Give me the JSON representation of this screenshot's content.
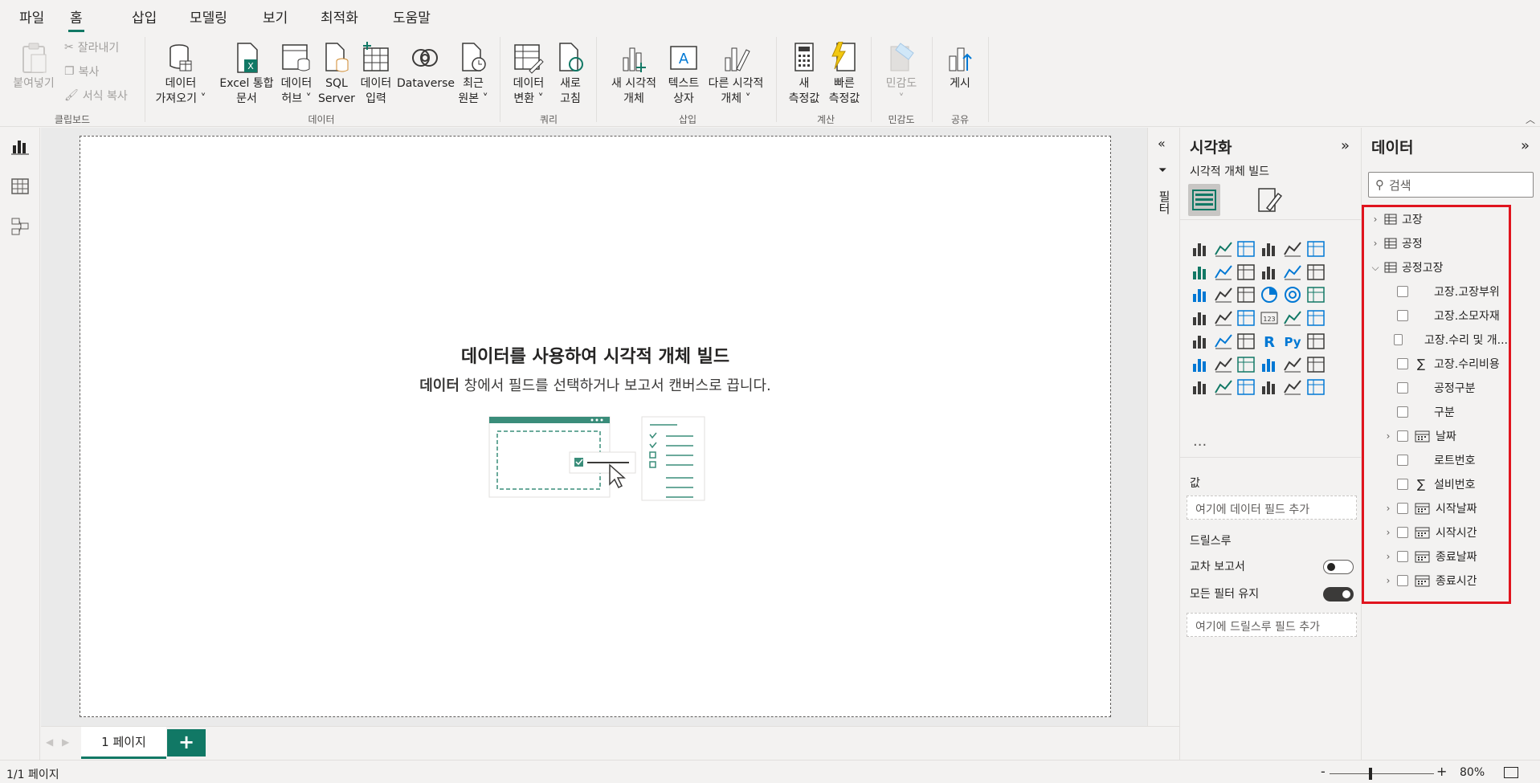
{
  "menu": [
    "파일",
    "홈",
    "삽입",
    "모델링",
    "보기",
    "최적화",
    "도움말"
  ],
  "ribbon": {
    "clipboard": {
      "paste": "붙여넣기",
      "cut": "잘라내기",
      "copy": "복사",
      "format_painter": "서식 복사",
      "group": "클립보드"
    },
    "data": {
      "get_data_1": "데이터",
      "get_data_2": "가져오기 ˅",
      "excel_1": "Excel 통합",
      "excel_2": "문서",
      "hub_1": "데이터",
      "hub_2": "허브 ˅",
      "sql_1": "SQL",
      "sql_2": "Server",
      "enter_1": "데이터",
      "enter_2": "입력",
      "dataverse": "Dataverse",
      "recent_1": "최근",
      "recent_2": "원본 ˅",
      "group": "데이터"
    },
    "query": {
      "transform_1": "데이터",
      "transform_2": "변환 ˅",
      "refresh_1": "새로",
      "refresh_2": "고침",
      "group": "쿼리"
    },
    "insert": {
      "newvisual_1": "새 시각적",
      "newvisual_2": "개체",
      "textbox_1": "텍스트",
      "textbox_2": "상자",
      "morevisuals_1": "다른 시각적",
      "morevisuals_2": "개체 ˅",
      "group": "삽입"
    },
    "calc": {
      "newmeasure_1": "새",
      "newmeasure_2": "측정값",
      "quickmeasure_1": "빠른",
      "quickmeasure_2": "측정값",
      "group": "계산"
    },
    "sensitivity": {
      "label": "민감도",
      "arrow": "˅",
      "group": "민감도"
    },
    "share": {
      "publish": "게시",
      "group": "공유"
    }
  },
  "canvas": {
    "title": "데이터를 사용하여 시각적 개체 빌드",
    "sub_bold": "데이터",
    "sub_rest": " 창에서 필드를 선택하거나 보고서 캔버스로 끕니다."
  },
  "filters_label": "필터",
  "viz": {
    "title": "시각화",
    "subtitle": "시각적 개체 빌드",
    "more": "...",
    "values_label": "값",
    "values_placeholder": "여기에 데이터 필드 추가",
    "drillthrough_label": "드릴스루",
    "cross_report": "교차 보고서",
    "keep_filters": "모든 필터 유지",
    "drill_placeholder": "여기에 드릴스루 필드 추가",
    "cross_report_on": false,
    "keep_filters_on": true
  },
  "data_pane": {
    "title": "데이터",
    "search_placeholder": "검색",
    "tables": [
      {
        "name": "고장",
        "expanded": false
      },
      {
        "name": "공정",
        "expanded": false
      },
      {
        "name": "공정고장",
        "expanded": true
      }
    ],
    "fields": [
      {
        "name": "고장.고장부위",
        "icon": "none",
        "expandable": false
      },
      {
        "name": "고장.소모자재",
        "icon": "none",
        "expandable": false
      },
      {
        "name": "고장.수리 및 개...",
        "icon": "none",
        "expandable": false
      },
      {
        "name": "고장.수리비용",
        "icon": "sigma",
        "expandable": false
      },
      {
        "name": "공정구분",
        "icon": "none",
        "expandable": false
      },
      {
        "name": "구분",
        "icon": "none",
        "expandable": false
      },
      {
        "name": "날짜",
        "icon": "calendar",
        "expandable": true
      },
      {
        "name": "로트번호",
        "icon": "none",
        "expandable": false
      },
      {
        "name": "설비번호",
        "icon": "sigma",
        "expandable": false
      },
      {
        "name": "시작날짜",
        "icon": "calendar",
        "expandable": true
      },
      {
        "name": "시작시간",
        "icon": "calendar",
        "expandable": true
      },
      {
        "name": "종료날짜",
        "icon": "calendar",
        "expandable": true
      },
      {
        "name": "종료시간",
        "icon": "calendar",
        "expandable": true
      }
    ]
  },
  "pages": {
    "tab": "1 페이지",
    "add": "+"
  },
  "status": {
    "page_count": "1/1 페이지",
    "zoom_minus": "-",
    "zoom_plus": "+",
    "zoom": "80%"
  },
  "colors": {
    "accent": "#117865",
    "highlight": "#e0141e"
  }
}
